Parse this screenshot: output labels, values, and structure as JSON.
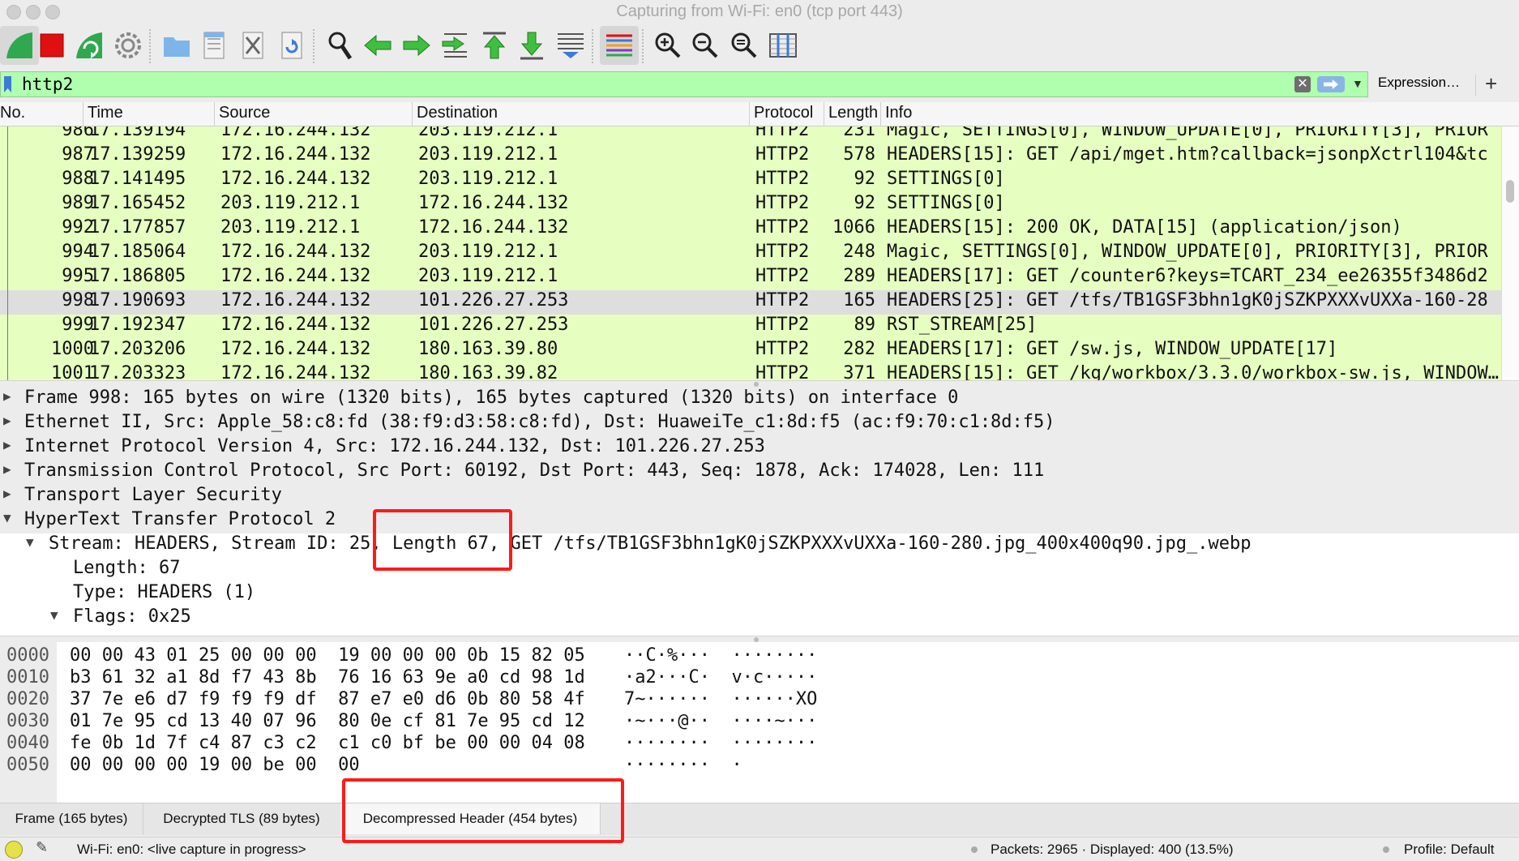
{
  "window": {
    "title": "Capturing from Wi-Fi: en0 (tcp port 443)"
  },
  "toolbar": {
    "buttons": [
      "start-capture-icon",
      "stop-capture-icon",
      "restart-capture-icon",
      "capture-options-icon",
      "open-file-icon",
      "save-file-icon",
      "close-file-icon",
      "reload-file-icon",
      "find-packet-icon",
      "go-back-icon",
      "go-forward-icon",
      "go-to-packet-icon",
      "first-packet-icon",
      "last-packet-icon",
      "autoscroll-icon",
      "colorize-icon",
      "zoom-in-icon",
      "zoom-out-icon",
      "normal-size-icon",
      "resize-columns-icon"
    ],
    "colors": {
      "green": "#2fa84f",
      "red": "#e01010",
      "blue": "#3b7bd6"
    }
  },
  "filter": {
    "value": "http2",
    "expression_label": "Expression…",
    "add_label": "+",
    "bg_color": "#afffaf"
  },
  "packet_list": {
    "columns": [
      "No.",
      "Time",
      "Source",
      "Destination",
      "Protocol",
      "Length",
      "Info"
    ],
    "rows": [
      {
        "no": "986",
        "time": "17.139194",
        "src": "172.16.244.132",
        "dst": "203.119.212.1",
        "proto": "HTTP2",
        "len": "231",
        "info": "Magic, SETTINGS[0], WINDOW_UPDATE[0], PRIORITY[3], PRIOR"
      },
      {
        "no": "987",
        "time": "17.139259",
        "src": "172.16.244.132",
        "dst": "203.119.212.1",
        "proto": "HTTP2",
        "len": "578",
        "info": "HEADERS[15]: GET /api/mget.htm?callback=jsonpXctrl104&tc"
      },
      {
        "no": "988",
        "time": "17.141495",
        "src": "172.16.244.132",
        "dst": "203.119.212.1",
        "proto": "HTTP2",
        "len": "92",
        "info": "SETTINGS[0]"
      },
      {
        "no": "989",
        "time": "17.165452",
        "src": "203.119.212.1",
        "dst": "172.16.244.132",
        "proto": "HTTP2",
        "len": "92",
        "info": "SETTINGS[0]"
      },
      {
        "no": "992",
        "time": "17.177857",
        "src": "203.119.212.1",
        "dst": "172.16.244.132",
        "proto": "HTTP2",
        "len": "1066",
        "info": "HEADERS[15]: 200 OK, DATA[15] (application/json)"
      },
      {
        "no": "994",
        "time": "17.185064",
        "src": "172.16.244.132",
        "dst": "203.119.212.1",
        "proto": "HTTP2",
        "len": "248",
        "info": "Magic, SETTINGS[0], WINDOW_UPDATE[0], PRIORITY[3], PRIOR"
      },
      {
        "no": "995",
        "time": "17.186805",
        "src": "172.16.244.132",
        "dst": "203.119.212.1",
        "proto": "HTTP2",
        "len": "289",
        "info": "HEADERS[17]: GET /counter6?keys=TCART_234_ee26355f3486d2"
      },
      {
        "no": "998",
        "time": "17.190693",
        "src": "172.16.244.132",
        "dst": "101.226.27.253",
        "proto": "HTTP2",
        "len": "165",
        "info": "HEADERS[25]: GET /tfs/TB1GSF3bhn1gK0jSZKPXXXvUXXa-160-28"
      },
      {
        "no": "999",
        "time": "17.192347",
        "src": "172.16.244.132",
        "dst": "101.226.27.253",
        "proto": "HTTP2",
        "len": "89",
        "info": "RST_STREAM[25]"
      },
      {
        "no": "1000",
        "time": "17.203206",
        "src": "172.16.244.132",
        "dst": "180.163.39.80",
        "proto": "HTTP2",
        "len": "282",
        "info": "HEADERS[17]: GET /sw.js, WINDOW_UPDATE[17]"
      },
      {
        "no": "1001",
        "time": "17.203323",
        "src": "172.16.244.132",
        "dst": "180.163.39.82",
        "proto": "HTTP2",
        "len": "371",
        "info": "HEADERS[15]: GET /kg/workbox/3.3.0/workbox-sw.js, WINDOW…"
      }
    ],
    "selected_no": "998",
    "row_color": "#e6ffc0",
    "selected_color": "#dedede"
  },
  "details": {
    "rows": [
      {
        "arrow": "▶",
        "text": "Frame 998: 165 bytes on wire (1320 bits), 165 bytes captured (1320 bits) on interface 0"
      },
      {
        "arrow": "▶",
        "text": "Ethernet II, Src: Apple_58:c8:fd (38:f9:d3:58:c8:fd), Dst: HuaweiTe_c1:8d:f5 (ac:f9:70:c1:8d:f5)"
      },
      {
        "arrow": "▶",
        "text": "Internet Protocol Version 4, Src: 172.16.244.132, Dst: 101.226.27.253"
      },
      {
        "arrow": "▶",
        "text": "Transmission Control Protocol, Src Port: 60192, Dst Port: 443, Seq: 1878, Ack: 174028, Len: 111"
      },
      {
        "arrow": "▶",
        "text": "Transport Layer Security"
      },
      {
        "arrow": "▼",
        "text": "HyperText Transfer Protocol 2"
      },
      {
        "arrow": "▼",
        "text": "Stream: HEADERS, Stream ID: 25, Length 67, GET /tfs/TB1GSF3bhn1gK0jSZKPXXXvUXXa-160-280.jpg_400x400q90.jpg_.webp"
      },
      {
        "arrow": "",
        "text": "Length: 67"
      },
      {
        "arrow": "",
        "text": "Type: HEADERS (1)"
      },
      {
        "arrow": "▼",
        "text": "Flags: 0x25"
      }
    ]
  },
  "bytes": {
    "rows": [
      {
        "offset": "0000",
        "hex": "00 00 43 01 25 00 00 00  19 00 00 00 0b 15 82 05",
        "ascii": "··C·%···  ········"
      },
      {
        "offset": "0010",
        "hex": "b3 61 32 a1 8d f7 43 8b  76 16 63 9e a0 cd 98 1d",
        "ascii": "·a2···C·  v·c·····"
      },
      {
        "offset": "0020",
        "hex": "37 7e e6 d7 f9 f9 f9 df  87 e7 e0 d6 0b 80 58 4f",
        "ascii": "7~······  ······XO"
      },
      {
        "offset": "0030",
        "hex": "01 7e 95 cd 13 40 07 96  80 0e cf 81 7e 95 cd 12",
        "ascii": "·~···@··  ····~···"
      },
      {
        "offset": "0040",
        "hex": "fe 0b 1d 7f c4 87 c3 c2  c1 c0 bf be 00 00 04 08",
        "ascii": "········  ········"
      },
      {
        "offset": "0050",
        "hex": "00 00 00 00 19 00 be 00  00",
        "ascii": "········  ·"
      }
    ]
  },
  "byte_tabs": [
    {
      "label": "Frame (165 bytes)",
      "active": false
    },
    {
      "label": "Decrypted TLS (89 bytes)",
      "active": false
    },
    {
      "label": "Decompressed Header (454 bytes)",
      "active": true
    }
  ],
  "status": {
    "capture": "Wi-Fi: en0: <live capture in progress>",
    "packets": "Packets: 2965 · Displayed: 400 (13.5%)",
    "profile": "Profile: Default"
  },
  "annotations": {
    "highlight_color": "#ff1a1a"
  }
}
